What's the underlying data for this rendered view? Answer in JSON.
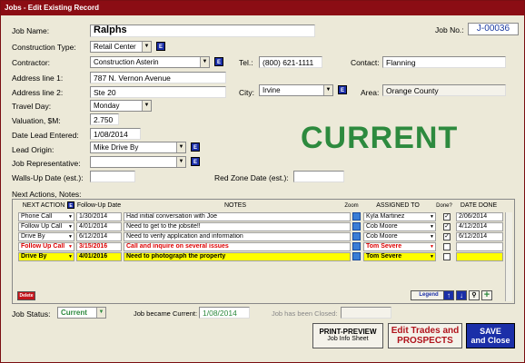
{
  "title": "Jobs - Edit Existing Record",
  "status": "CURRENT",
  "fields": {
    "job_name_label": "Job Name:",
    "job_name": "Ralphs",
    "job_no_label": "Job No.:",
    "job_no": "J-00036",
    "construction_type_label": "Construction Type:",
    "construction_type": "Retail Center",
    "contractor_label": "Contractor:",
    "contractor": "Construction Asterin",
    "tel_label": "Tel.:",
    "tel": "(800) 621-1111",
    "contact_label": "Contact:",
    "contact": "Flanning",
    "address1_label": "Address line 1:",
    "address1": "787 N. Vernon Avenue",
    "address2_label": "Address line 2:",
    "address2": "Ste 20",
    "city_label": "City:",
    "city": "Irvine",
    "area_label": "Area:",
    "area": "Orange County",
    "travel_day_label": "Travel Day:",
    "travel_day": "Monday",
    "valuation_label": "Valuation, $M:",
    "valuation": "2.750",
    "date_lead_label": "Date Lead Entered:",
    "date_lead": "1/08/2014",
    "lead_origin_label": "Lead Origin:",
    "lead_origin": "Mike Drive By",
    "job_rep_label": "Job Representative:",
    "job_rep": "",
    "walls_up_label": "Walls-Up Date (est.):",
    "walls_up": "",
    "red_zone_label": "Red Zone Date (est.):",
    "red_zone": ""
  },
  "actions": {
    "section_label": "Next Actions, Notes:",
    "headers": {
      "next_action": "NEXT ACTION",
      "follow_up": "Follow-Up Date",
      "notes": "NOTES",
      "zoom": "Zoom",
      "assigned": "ASSIGNED TO",
      "done": "Done?",
      "date_done": "DATE DONE"
    },
    "rows": [
      {
        "action": "Phone Call",
        "date": "1/30/2014",
        "notes": "Had initial conversation with Joe",
        "assigned": "Kyla Martinez",
        "done": true,
        "date_done": "2/06/2014"
      },
      {
        "action": "Follow Up Call",
        "date": "4/01/2014",
        "notes": "Need to get to the jobsite!!",
        "assigned": "Cob Moore",
        "done": true,
        "date_done": "4/12/2014"
      },
      {
        "action": "Drive By",
        "date": "6/12/2014",
        "notes": "Need to verify application and information",
        "assigned": "Cob Moore",
        "done": true,
        "date_done": "6/12/2014"
      },
      {
        "action": "Follow Up Call",
        "date": "3/15/2016",
        "notes": "Call and inquire on several issues",
        "assigned": "Tom Severe",
        "done": false,
        "date_done": ""
      },
      {
        "action": "Drive By",
        "date": "4/01/2016",
        "notes": "Need to photograph the property",
        "assigned": "Tom Severe",
        "done": false,
        "date_done": ""
      }
    ],
    "delete_label": "Delete",
    "legend_label": "Legend"
  },
  "footer": {
    "job_status_label": "Job Status:",
    "job_status": "Current",
    "became_current_label": "Job became Current:",
    "became_current": "1/08/2014",
    "closed_label": "Job has been Closed:",
    "closed": "",
    "print_btn_line1": "PRINT-PREVIEW",
    "print_btn_line2": "Job Info Sheet",
    "trades_btn_line1": "Edit Trades and",
    "trades_btn_line2": "PROSPECTS",
    "save_btn_line1": "SAVE",
    "save_btn_line2": "and Close"
  },
  "colors": {
    "title_bar": "#8b0d14",
    "status_text": "#2d8a3e",
    "red_row": "#dd0000",
    "highlight_row": "#ffff00",
    "save_button": "#1b2fa8",
    "trades_text": "#b0131c"
  }
}
